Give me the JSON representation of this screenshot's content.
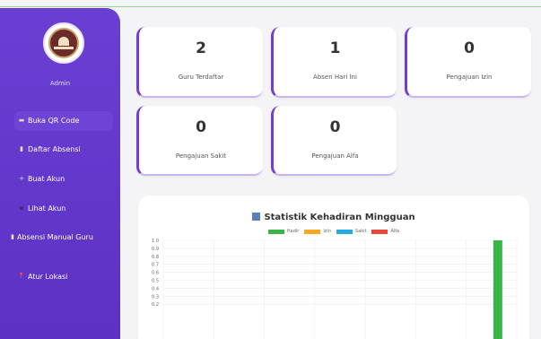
{
  "sidebar": {
    "role_label": "Admin",
    "items": [
      {
        "label": "Buka QR Code",
        "icon": "qr-code-icon",
        "glyph": "▬"
      },
      {
        "label": "Daftar Absensi",
        "icon": "clipboard-icon",
        "glyph": "▮"
      },
      {
        "label": "Buat Akun",
        "icon": "plus-icon",
        "glyph": "+"
      },
      {
        "label": "Lihat Akun",
        "icon": "users-icon",
        "glyph": "▪"
      },
      {
        "label": "Absensi Manual Guru",
        "icon": "document-icon",
        "glyph": "▮"
      },
      {
        "label": "Atur Lokasi",
        "icon": "pin-icon",
        "glyph": "📍"
      }
    ]
  },
  "stats": [
    {
      "value": "2",
      "label": "Guru Terdaftar"
    },
    {
      "value": "1",
      "label": "Absen Hari Ini"
    },
    {
      "value": "0",
      "label": "Pengajuan Izin"
    },
    {
      "value": "0",
      "label": "Pengajuan Sakit"
    },
    {
      "value": "0",
      "label": "Pengajuan Alfa"
    }
  ],
  "chart_data": {
    "type": "bar",
    "title": "Statistik Kehadiran Mingguan",
    "legend_position": "top",
    "series": [
      {
        "name": "Hadir",
        "color": "#3bb54a"
      },
      {
        "name": "Izin",
        "color": "#f5a623"
      },
      {
        "name": "Sakit",
        "color": "#27a8e0"
      },
      {
        "name": "Alfa",
        "color": "#e8453c"
      }
    ],
    "y_ticks": [
      "1.0",
      "0.9",
      "0.8",
      "0.7",
      "0.6",
      "0.5",
      "0.4",
      "0.3",
      "0.2"
    ],
    "ylim": [
      0,
      1.0
    ],
    "category_count": 7,
    "bars": [
      {
        "category_index": 6,
        "series": "Hadir",
        "value": 1.0
      }
    ],
    "grid": true
  }
}
